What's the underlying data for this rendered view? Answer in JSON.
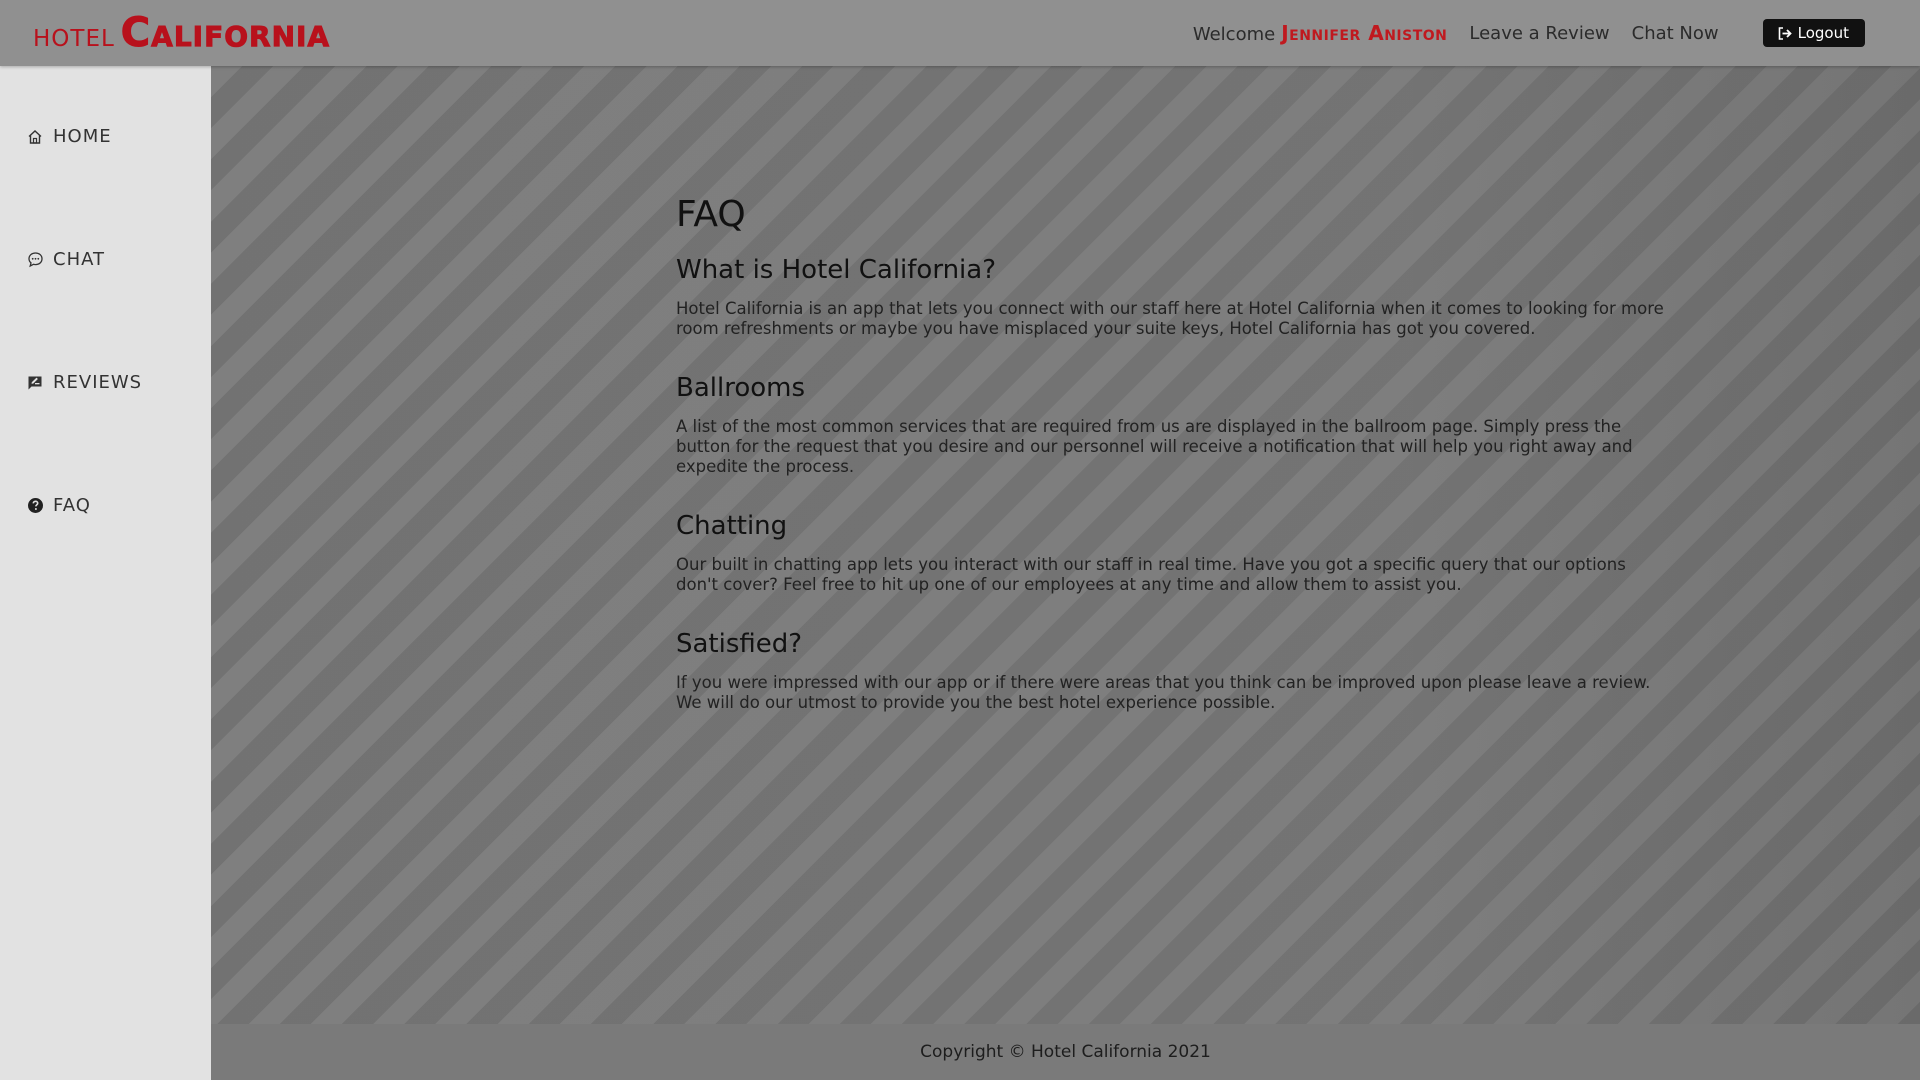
{
  "brand": {
    "small": "HOTEL",
    "big": "California",
    "brand_color": "#b8111c"
  },
  "header": {
    "welcome_label": "Welcome",
    "user_name": "Jennifer Aniston",
    "links": [
      "Leave a Review",
      "Chat Now"
    ],
    "logout_label": "Logout",
    "logout_icon": "sign-out-icon"
  },
  "sidebar": {
    "items": [
      {
        "label": "HOME",
        "icon": "home-icon"
      },
      {
        "label": "CHAT",
        "icon": "chat-icon"
      },
      {
        "label": "REVIEWS",
        "icon": "review-icon"
      },
      {
        "label": "FAQ",
        "icon": "question-circle-icon"
      }
    ]
  },
  "main": {
    "title": "FAQ",
    "faqs": [
      {
        "question": "What is Hotel California?",
        "answer": "Hotel California is an app that lets you connect with our staff here at Hotel California when it comes to looking for more room refreshments or maybe you have misplaced your suite keys, Hotel California has got you covered."
      },
      {
        "question": "Ballrooms",
        "answer": "A list of the most common services that are required from us are displayed in the ballroom page. Simply press the button for the request that you desire and our personnel will receive a notification that will help you right away and expedite the process."
      },
      {
        "question": "Chatting",
        "answer": "Our built in chatting app lets you interact with our staff in real time. Have you got a specific query that our options don't cover? Feel free to hit up one of our employees at any time and allow them to assist you."
      },
      {
        "question": "Satisfied?",
        "answer": "If you were impressed with our app or if there were areas that you think can be improved upon please leave a review. We will do our utmost to provide you the best hotel experience possible."
      }
    ]
  },
  "footer": {
    "text": "Copyright © Hotel California 2021"
  }
}
